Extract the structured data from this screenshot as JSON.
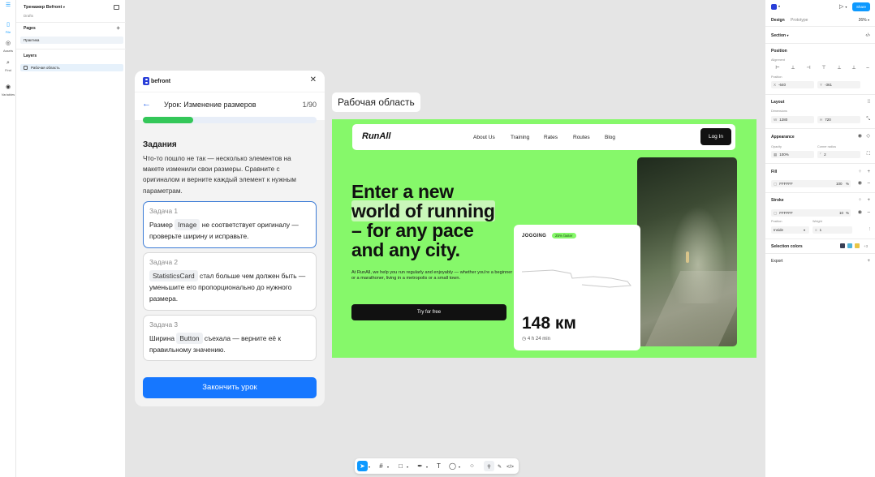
{
  "rail": {
    "items": [
      {
        "label": "File"
      },
      {
        "label": "Assets"
      },
      {
        "label": "Find"
      },
      {
        "label": "Variables"
      }
    ]
  },
  "left_panel": {
    "project_title": "Тренажер Befront",
    "project_location": "Drafts",
    "pages_heading": "Pages",
    "pages": [
      "Практика"
    ],
    "layers_heading": "Layers",
    "layers": [
      "Рабочая область"
    ]
  },
  "lesson": {
    "logo_text": "befront",
    "title": "Урок: Изменение размеров",
    "counter": "1/90",
    "progress": 0.29,
    "tasks_heading": "Задания",
    "tasks_description": "Что-то пошло не так — несколько элементов на макете изменили свои размеры. Сравните с оригиналом и верните каждый элемент к нужным параметрам.",
    "tasks": [
      {
        "title": "Задача 1",
        "before": "Размер",
        "chip": "Image",
        "after": "не соответствует оригиналу — проверьте ширину и исправьте.",
        "active": true
      },
      {
        "title": "Задача 2",
        "before": "",
        "chip": "StatisticsCard",
        "after": "стал больше чем должен быть — уменьшите его пропорционально до нужного размера.",
        "active": false
      },
      {
        "title": "Задача 3",
        "before": "Ширина",
        "chip": "Button",
        "after": "съехала — верните её к правильному значению.",
        "active": false
      }
    ],
    "finish_label": "Закончить урок"
  },
  "canvas": {
    "frame_label": "Рабочая область",
    "site": {
      "brand": "RunAll",
      "nav": [
        "About Us",
        "Training",
        "Rates",
        "Routes",
        "Blog"
      ],
      "login_label": "Log In",
      "hero_lines": [
        "Enter a new",
        "world of running",
        "– for any pace",
        "and any city."
      ],
      "hero_sub": "At RunAll, we help you run regularly and enjoyably — whether you're a beginner or a marathoner, living in a metropolis or a small town.",
      "cta_label": "Try for free",
      "stat": {
        "activity": "JOGGING",
        "badge": "25% faster",
        "distance": "148 км",
        "time": "4 h 24 min"
      }
    }
  },
  "toolbar": {
    "tools": [
      "move-tool",
      "frame-tool",
      "shape-tool",
      "pen-tool",
      "text-tool",
      "comment-tool",
      "components-tool",
      "dev-mode-toggle",
      "code-tool"
    ]
  },
  "right_panel": {
    "share_label": "Share",
    "tabs": [
      "Design",
      "Prototype"
    ],
    "zoom": "26%",
    "section_label": "Section",
    "position_heading": "Position",
    "alignment_label": "Alignment",
    "position_label": "Position",
    "x_key": "X",
    "x_value": "-640",
    "y_key": "Y",
    "y_value": "-361",
    "layout_heading": "Layout",
    "dimensions_label": "Dimensions",
    "w_key": "W",
    "w_value": "1280",
    "h_key": "H",
    "h_value": "720",
    "appearance_heading": "Appearance",
    "opacity_label": "Opacity",
    "opacity_value": "100%",
    "corner_label": "Corner radius",
    "corner_value": "2",
    "fill_heading": "Fill",
    "fill_hex": "FFFFFF",
    "fill_opacity": "100",
    "fill_pct": "%",
    "stroke_heading": "Stroke",
    "stroke_hex": "FFFFFF",
    "stroke_opacity": "10",
    "stroke_pct": "%",
    "stroke_position_label": "Position",
    "stroke_position_value": "Inside",
    "weight_label": "Weight",
    "weight_value": "1",
    "selection_colors_heading": "Selection colors",
    "selection_colors": [
      "#3a3f55",
      "#4fb3d9",
      "#e8c547"
    ],
    "selection_more": "+3",
    "export_heading": "Export"
  },
  "colors": {
    "accent": "#0d99ff",
    "frame_green": "#86f86a",
    "lesson_button": "#1677ff",
    "progress_green": "#34c759"
  }
}
